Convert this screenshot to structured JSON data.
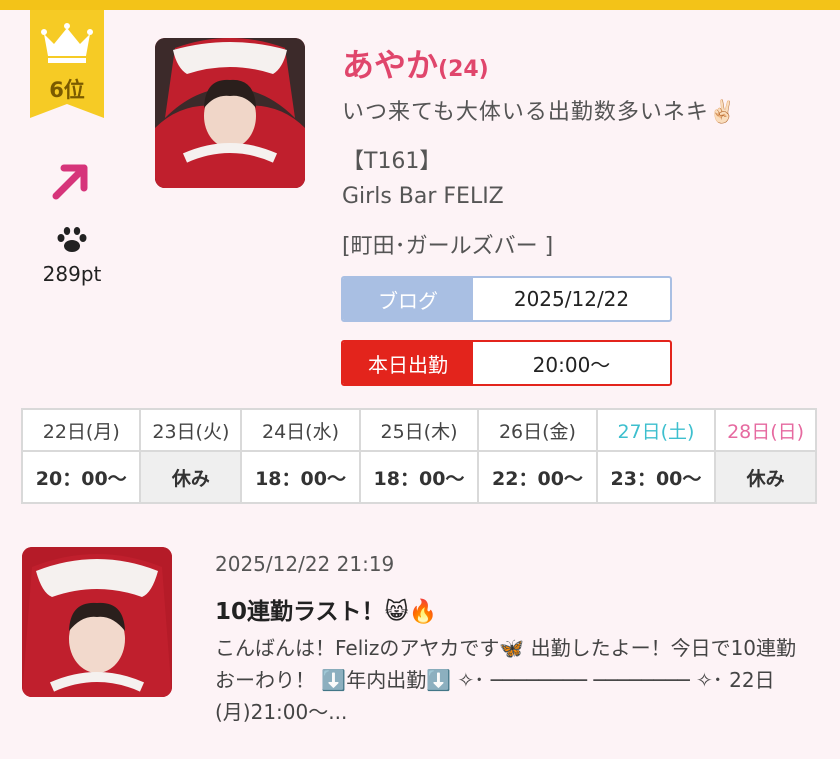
{
  "rank": {
    "label": "6位",
    "points": "289pt",
    "trend_icon": "arrow-up-right-icon",
    "paw_icon": "paw-icon"
  },
  "profile": {
    "name": "あやか",
    "age": "(24)",
    "catchphrase": "いつ来ても大体いる出勤数多いネキ",
    "emoji": "✌🏻",
    "tline": "【T161】",
    "shop": "Girls Bar FELIZ",
    "area": "[町田･ガールズバー ]"
  },
  "blog": {
    "label": "ブログ",
    "date": "2025/12/22"
  },
  "today": {
    "label": "本日出勤",
    "time": "20:00〜"
  },
  "schedule": {
    "days": [
      "22日(月)",
      "23日(火)",
      "24日(水)",
      "25日(木)",
      "26日(金)",
      "27日(土)",
      "28日(日)"
    ],
    "times": [
      "20：00〜",
      "休み",
      "18：00〜",
      "18：00〜",
      "22：00〜",
      "23：00〜",
      "休み"
    ]
  },
  "post": {
    "datetime": "2025/12/22 21:19",
    "title": "10連勤ラスト！😸🔥",
    "body": "こんばんは！Felizのアヤカです🦋 出勤したよー！今日で10連勤おーわり！ ⬇️年内出勤⬇️ ✧･ ──────── ──────── ✧･ 22日(月)21:00〜..."
  },
  "colors": {
    "accent_pink": "#e0466c",
    "gold": "#f3c318",
    "blog_blue": "#a9bfe3",
    "work_red": "#e3241c"
  }
}
